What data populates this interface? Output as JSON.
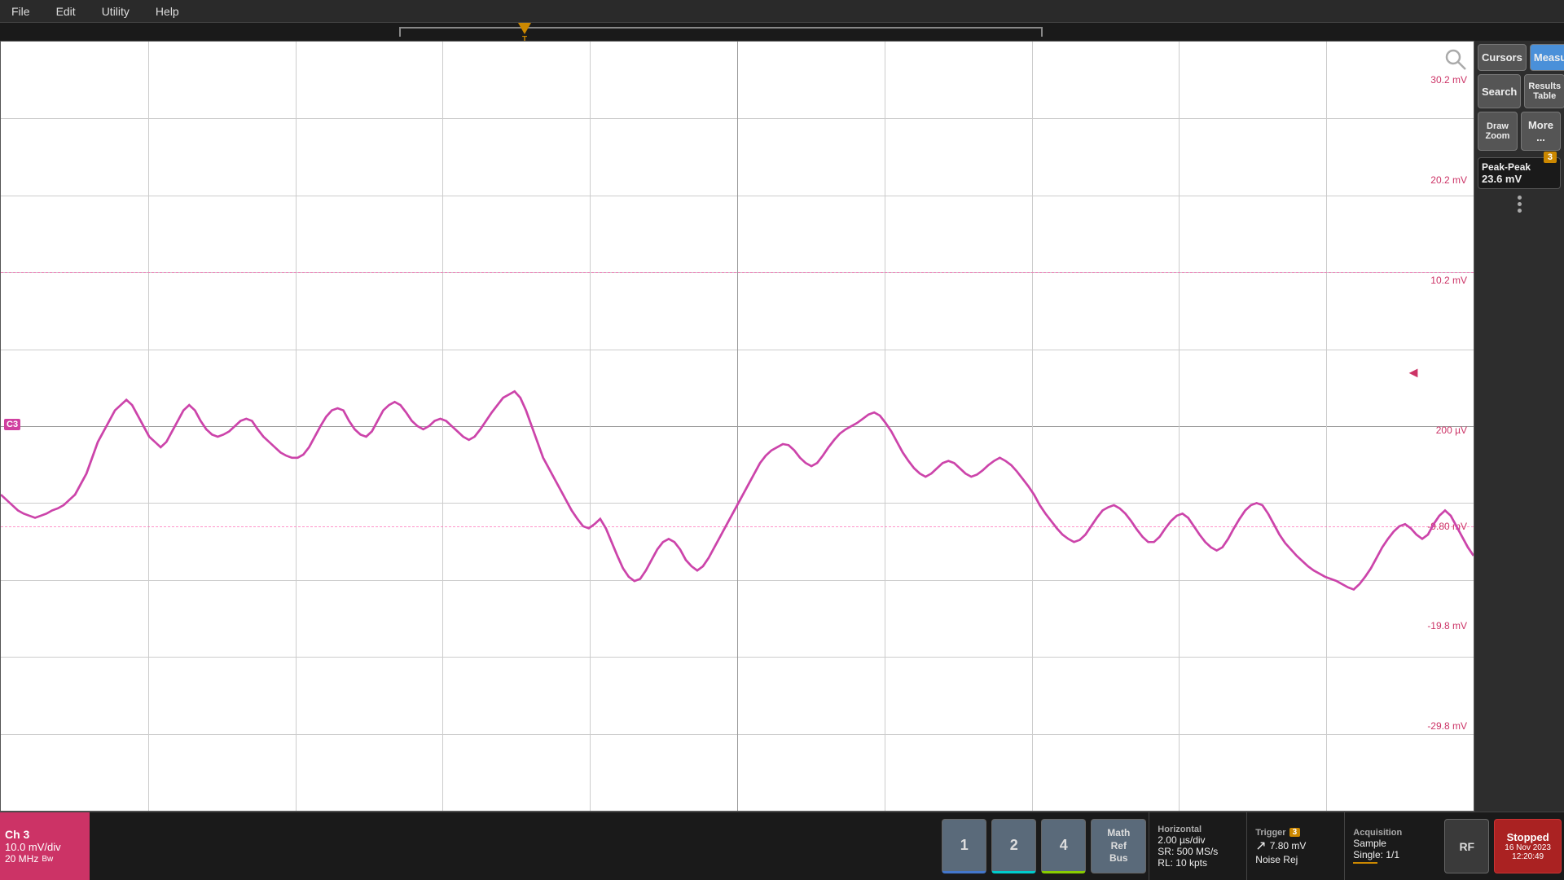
{
  "menu": {
    "items": [
      "File",
      "Edit",
      "Utility",
      "Help"
    ]
  },
  "scope": {
    "voltage_labels": [
      {
        "value": "30.2 mV",
        "pct": 5
      },
      {
        "value": "20.2 mV",
        "pct": 18
      },
      {
        "value": "10.2 mV",
        "pct": 31
      },
      {
        "value": "200 µV",
        "pct": 52
      },
      {
        "value": "-9.80 mV",
        "pct": 65
      },
      {
        "value": "-19.8 mV",
        "pct": 77
      },
      {
        "value": "-29.8 mV",
        "pct": 90
      }
    ],
    "ch_label": "C3",
    "trigger_t": "T"
  },
  "right_panel": {
    "cursors_label": "Cursors",
    "measure_label": "Measure",
    "search_label": "Search",
    "results_table_label": "Results\nTable",
    "draw_zoom_label": "Draw\nZoom",
    "more_label": "More ...",
    "measurement": {
      "badge": "3",
      "title": "Peak-Peak",
      "value": "23.6 mV"
    }
  },
  "status_bar": {
    "ch3": {
      "title": "Ch 3",
      "vdiv": "10.0 mV/div",
      "freq": "20 MHz",
      "bw": "Bw"
    },
    "channels": [
      {
        "label": "1",
        "class": "ch1"
      },
      {
        "label": "2",
        "class": "ch2"
      },
      {
        "label": "4",
        "class": "ch4"
      }
    ],
    "math_ref_bus": "Math\nRef\nBus",
    "horizontal": {
      "title": "Horizontal",
      "time_div": "2.00 µs/div",
      "sr": "SR: 500 MS/s",
      "rl": "RL: 10 kpts"
    },
    "trigger": {
      "title": "Trigger",
      "badge": "3",
      "slope": "7.80 mV",
      "noise_rej": "Noise Rej"
    },
    "acquisition": {
      "title": "Acquisition",
      "mode": "Sample",
      "single": "Single: 1/1"
    },
    "rf_label": "RF",
    "stopped": {
      "label": "Stopped",
      "date": "16 Nov 2023",
      "time": "12:20:49"
    }
  }
}
